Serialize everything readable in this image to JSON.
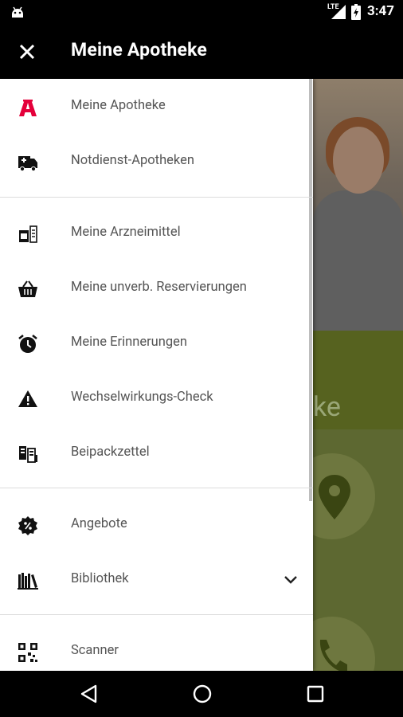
{
  "status_bar": {
    "network": "LTE",
    "time": "3:47"
  },
  "app_bar": {
    "title": "Meine Apotheke"
  },
  "drawer": {
    "items": [
      {
        "label": "Meine Apotheke",
        "icon": "pharmacy-a-icon"
      },
      {
        "label": "Notdienst-Apotheken",
        "icon": "ambulance-icon"
      },
      {
        "label": "Meine Arzneimittel",
        "icon": "medicine-box-icon"
      },
      {
        "label": "Meine unverb. Reservierungen",
        "icon": "basket-icon"
      },
      {
        "label": "Meine Erinnerungen",
        "icon": "alarm-clock-icon"
      },
      {
        "label": "Wechselwirkungs-Check",
        "icon": "warning-icon"
      },
      {
        "label": "Beipackzettel",
        "icon": "leaflet-icon"
      },
      {
        "label": "Angebote",
        "icon": "discount-badge-icon"
      },
      {
        "label": "Bibliothek",
        "icon": "library-icon"
      },
      {
        "label": "Scanner",
        "icon": "qr-code-icon"
      }
    ]
  },
  "background": {
    "partial_text": "ke"
  },
  "colors": {
    "accent_red": "#e4003a",
    "drawer_bg": "#ffffff",
    "green": "#56621f"
  }
}
